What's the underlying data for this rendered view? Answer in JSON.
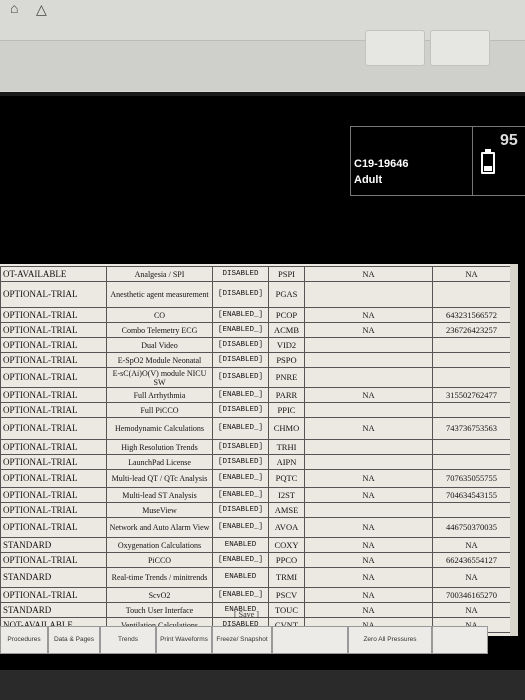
{
  "patient": {
    "id": "C19-19646",
    "type": "Adult"
  },
  "battery": {
    "value": "95",
    "icon": "battery-icon"
  },
  "table": {
    "rows": [
      {
        "status": "OT-AVAILABLE",
        "feature": "Analgesia / SPI",
        "state": "DISABLED",
        "code": "PSPI",
        "col5": "NA",
        "col6": "NA"
      },
      {
        "status": "OPTIONAL-TRIAL",
        "feature": "Anesthetic agent measurement",
        "state": "[DISABLED]",
        "code": "PGAS",
        "col5": "",
        "col6": ""
      },
      {
        "status": "OPTIONAL-TRIAL",
        "feature": "CO",
        "state": "[ENABLED_]",
        "code": "PCOP",
        "col5": "NA",
        "col6": "643231566572"
      },
      {
        "status": "OPTIONAL-TRIAL",
        "feature": "Combo Telemetry ECG",
        "state": "[ENABLED_]",
        "code": "ACMB",
        "col5": "NA",
        "col6": "236726423257"
      },
      {
        "status": "OPTIONAL-TRIAL",
        "feature": "Dual Video",
        "state": "[DISABLED]",
        "code": "VID2",
        "col5": "",
        "col6": ""
      },
      {
        "status": "OPTIONAL-TRIAL",
        "feature": "E-SpO2 Module Neonatal",
        "state": "[DISABLED]",
        "code": "PSPO",
        "col5": "",
        "col6": ""
      },
      {
        "status": "OPTIONAL-TRIAL",
        "feature": "E-sC(Ai)O(V) module NICU SW",
        "state": "[DISABLED]",
        "code": "PNRE",
        "col5": "",
        "col6": ""
      },
      {
        "status": "OPTIONAL-TRIAL",
        "feature": "Full Arrhythmia",
        "state": "[ENABLED_]",
        "code": "PARR",
        "col5": "NA",
        "col6": "315502762477"
      },
      {
        "status": "OPTIONAL-TRIAL",
        "feature": "Full PiCCO",
        "state": "[DISABLED]",
        "code": "PPIC",
        "col5": "",
        "col6": ""
      },
      {
        "status": "OPTIONAL-TRIAL",
        "feature": "Hemodynamic Calculations",
        "state": "[ENABLED_]",
        "code": "CHMO",
        "col5": "NA",
        "col6": "743736753563"
      },
      {
        "status": "OPTIONAL-TRIAL",
        "feature": "High Resolution Trends",
        "state": "[DISABLED]",
        "code": "TRHI",
        "col5": "",
        "col6": ""
      },
      {
        "status": "OPTIONAL-TRIAL",
        "feature": "LaunchPad License",
        "state": "[DISABLED]",
        "code": "AIPN",
        "col5": "",
        "col6": ""
      },
      {
        "status": "OPTIONAL-TRIAL",
        "feature": "Multi-lead QT / QTc Analysis",
        "state": "[ENABLED_]",
        "code": "PQTC",
        "col5": "NA",
        "col6": "707635055755"
      },
      {
        "status": "OPTIONAL-TRIAL",
        "feature": "Multi-lead ST Analysis",
        "state": "[ENABLED_]",
        "code": "I2ST",
        "col5": "NA",
        "col6": "704634543155"
      },
      {
        "status": "OPTIONAL-TRIAL",
        "feature": "MuseView",
        "state": "[DISABLED]",
        "code": "AMSE",
        "col5": "",
        "col6": ""
      },
      {
        "status": "OPTIONAL-TRIAL",
        "feature": "Network and Auto Alarm View",
        "state": "[ENABLED_]",
        "code": "AVOA",
        "col5": "NA",
        "col6": "446750370035"
      },
      {
        "status": "STANDARD",
        "feature": "Oxygenation Calculations",
        "state": "ENABLED",
        "code": "COXY",
        "col5": "NA",
        "col6": "NA"
      },
      {
        "status": "OPTIONAL-TRIAL",
        "feature": "PiCCO",
        "state": "[ENABLED_]",
        "code": "PPCO",
        "col5": "NA",
        "col6": "662436554127"
      },
      {
        "status": "STANDARD",
        "feature": "Real-time Trends / minitrends",
        "state": "ENABLED",
        "code": "TRMI",
        "col5": "NA",
        "col6": "NA"
      },
      {
        "status": "OPTIONAL-TRIAL",
        "feature": "ScvO2",
        "state": "[ENABLED_]",
        "code": "PSCV",
        "col5": "NA",
        "col6": "700346165270"
      },
      {
        "status": "STANDARD",
        "feature": "Touch User Interface",
        "state": "ENABLED",
        "code": "TOUC",
        "col5": "NA",
        "col6": "NA"
      },
      {
        "status": "NOT-AVAILABLE",
        "feature": "Ventilation Calculations",
        "state": "DISABLED",
        "code": "CVNT",
        "col5": "NA",
        "col6": "NA"
      }
    ],
    "save_label": "[ Save ]"
  },
  "softkeys": [
    {
      "label": "Procedures"
    },
    {
      "label": "Data & Pages"
    },
    {
      "label": "Trends"
    },
    {
      "label": "Print Waveforms"
    },
    {
      "label": "Freeze/ Snapshot"
    },
    {
      "label": ""
    },
    {
      "label": "Zero All Pressures"
    },
    {
      "label": ""
    }
  ]
}
